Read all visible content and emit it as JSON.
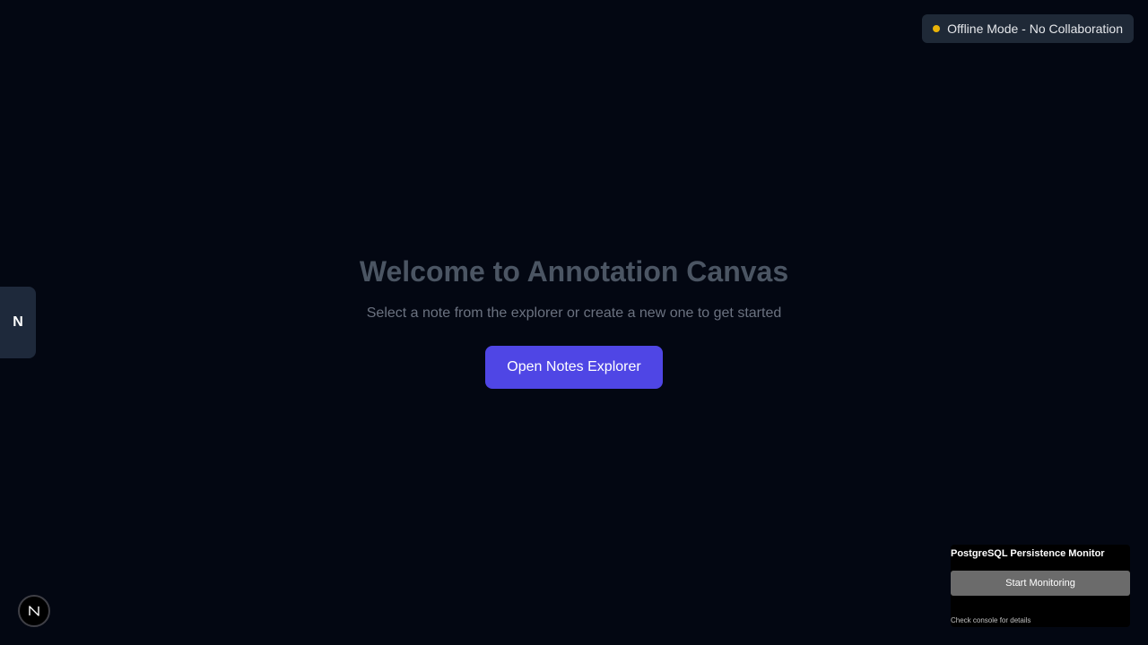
{
  "status": {
    "label": "Offline Mode - No Collaboration",
    "dot_color": "#eab308"
  },
  "side_tab": {
    "label": "N"
  },
  "welcome": {
    "title": "Welcome to Annotation Canvas",
    "subtitle": "Select a note from the explorer or create a new one to get started",
    "button_label": "Open Notes Explorer"
  },
  "monitor": {
    "title": "PostgreSQL Persistence Monitor",
    "button_label": "Start Monitoring",
    "note": "Check console for details"
  },
  "colors": {
    "background": "#030712",
    "accent": "#4f46e5"
  }
}
